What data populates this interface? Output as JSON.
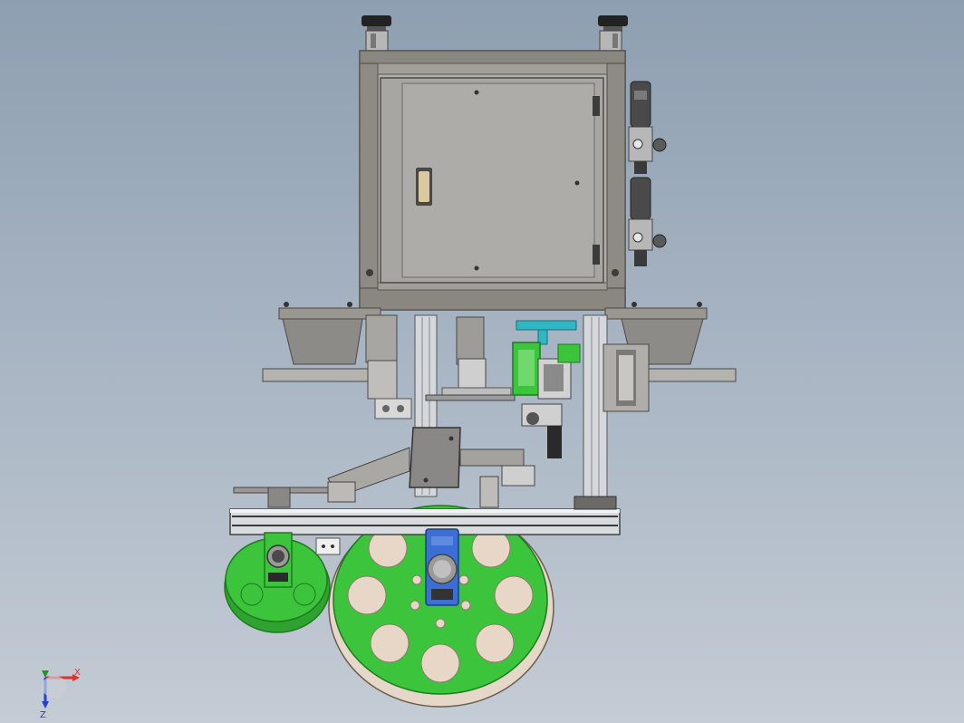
{
  "viewport": {
    "background_top": "#8e9fb1",
    "background_bottom": "#c4ccd5"
  },
  "triad": {
    "x_label": "X",
    "y_label": "Y",
    "z_label": "Z",
    "x_color": "#e03030",
    "y_color": "#2a8f2a",
    "z_color": "#2040d0"
  },
  "colors": {
    "frame_metal": "#9a9690",
    "panel": "#a8a6a2",
    "panel_dark": "#6d6b68",
    "aluminum": "#d4d8dc",
    "green_part": "#3cc43c",
    "green_dark": "#1f8f1f",
    "pad": "#e8d7c7",
    "blue_motor": "#3b6fd6",
    "cyan_part": "#2fb7c4",
    "black_part": "#2a2a2a"
  }
}
